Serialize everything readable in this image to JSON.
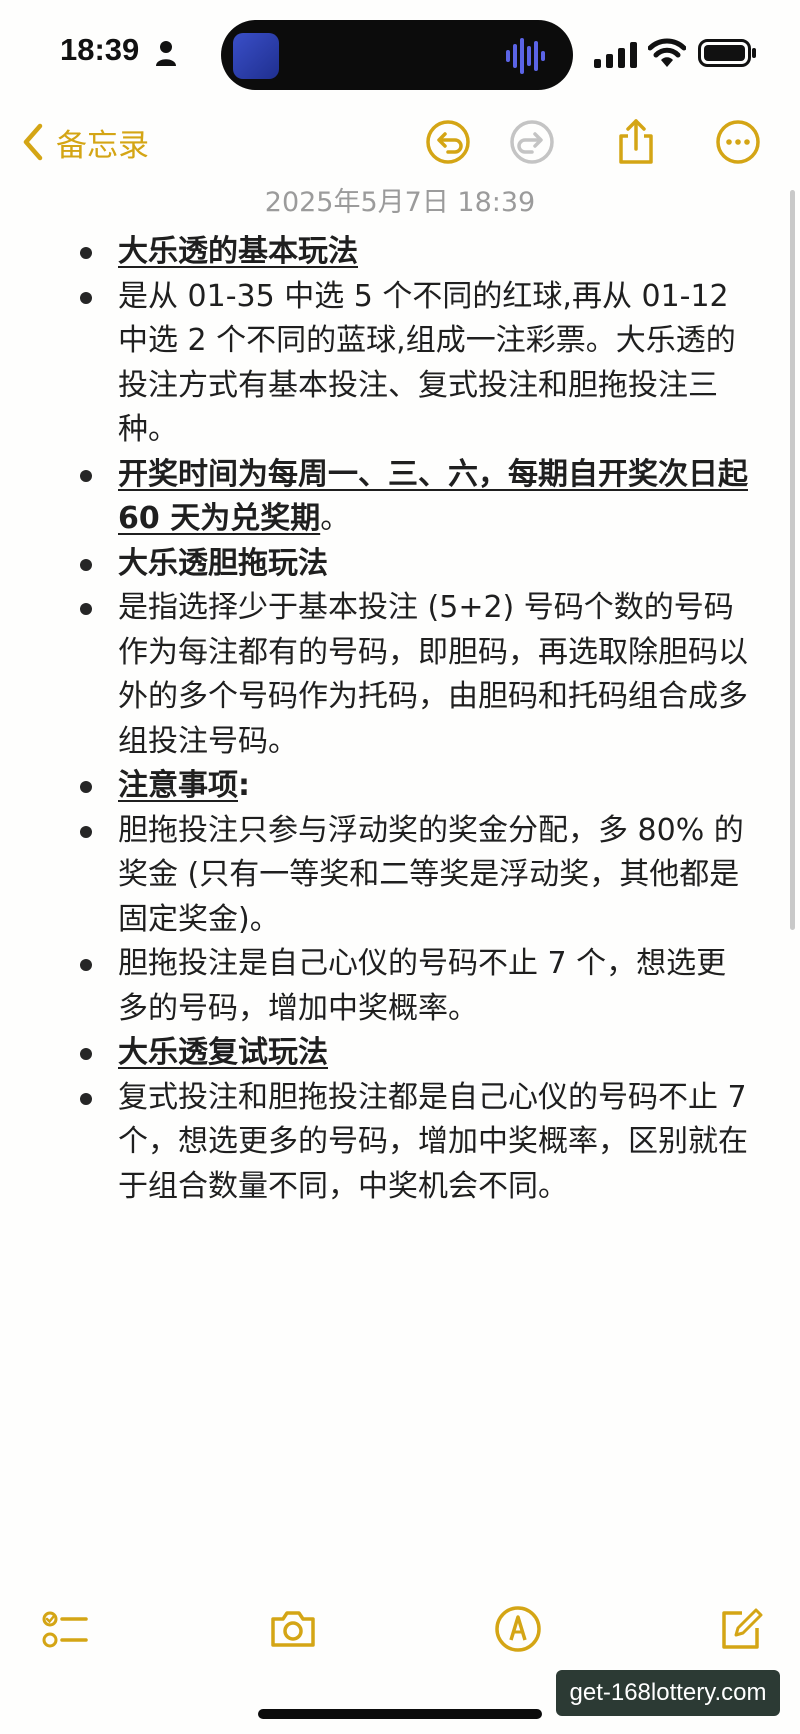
{
  "status_bar": {
    "time": "18:39",
    "icons": [
      "person-icon",
      "signal-icon",
      "wifi-icon",
      "battery-icon"
    ]
  },
  "nav": {
    "back_label": "备忘录",
    "icons": [
      "chevron-left-icon",
      "undo-icon",
      "redo-icon",
      "share-icon",
      "more-icon"
    ]
  },
  "note": {
    "date": "2025年5月7日 18:39",
    "items": [
      {
        "heading": "大乐透的基本玩法",
        "text": ""
      },
      {
        "heading": "",
        "text": "是从 01-35 中选 5 个不同的红球,再从 01-12 中选 2 个不同的蓝球,组成一注彩票。大乐透的投注方式有基本投注、复式投注和胆拖投注三种。"
      },
      {
        "heading": "开奖时间为每周一、三、六，每期自开奖次日起 60 天为兑奖期",
        "text": "。"
      },
      {
        "heading": "",
        "text": "大乐透胆拖玩法"
      },
      {
        "heading": "",
        "text": "是指选择少于基本投注 (5+2) 号码个数的号码作为每注都有的号码，即胆码，再选取除胆码以外的多个号码作为托码，由胆码和托码组合成多组投注号码。"
      },
      {
        "heading": "注意事项",
        "text": ":"
      },
      {
        "heading": "",
        "text": "胆拖投注只参与浮动奖的奖金分配，多 80% 的奖金 (只有一等奖和二等奖是浮动奖，其他都是固定奖金)。"
      },
      {
        "heading": "",
        "text": "胆拖投注是自己心仪的号码不止 7 个，想选更多的号码，增加中奖概率。"
      },
      {
        "heading": "大乐透复试玩法",
        "text": ""
      },
      {
        "heading": "",
        "text": "复式投注和胆拖投注都是自己心仪的号码不止 7 个，想选更多的号码，增加中奖概率，区别就在于组合数量不同，中奖机会不同。"
      }
    ]
  },
  "toolbar": {
    "icons": [
      "checklist-icon",
      "camera-icon",
      "markup-pen-icon",
      "compose-icon"
    ]
  },
  "watermark": "get-168lottery.com",
  "colors": {
    "accent": "#d4a515",
    "background": "#fefefd",
    "text": "#1f1f1f",
    "date": "#9b9b9b"
  }
}
